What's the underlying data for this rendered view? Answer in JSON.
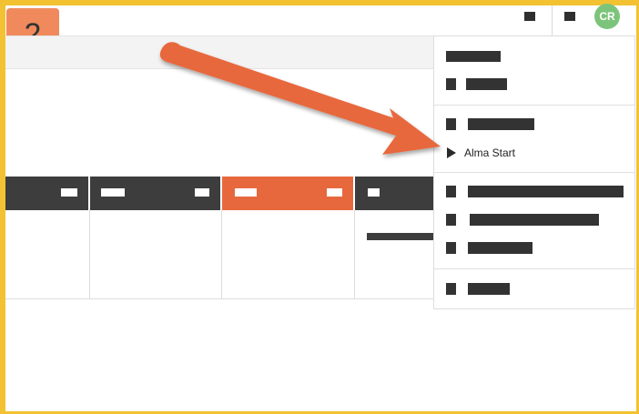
{
  "step": {
    "number": "2"
  },
  "user": {
    "initials": "CR"
  },
  "menu": {
    "start_item_label": "Alma Start"
  },
  "colors": {
    "frame": "#f2c232",
    "badge": "#f08a5d",
    "arrow": "#e8683e",
    "active_tab": "#e8683e",
    "avatar": "#7cc47a"
  },
  "icons": [
    "play-icon",
    "arrow-pointer-icon"
  ]
}
